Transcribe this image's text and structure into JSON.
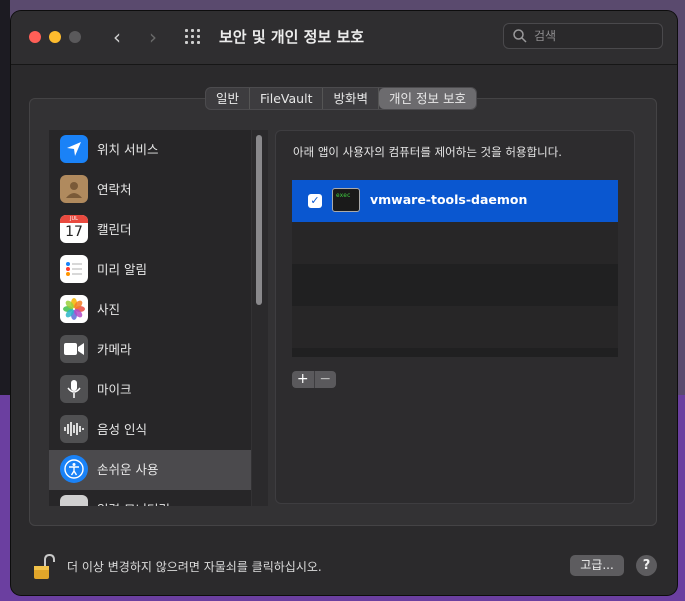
{
  "window": {
    "title": "보안 및 개인 정보 보호",
    "search_placeholder": "검색"
  },
  "tabs": [
    {
      "label": "일반",
      "active": false
    },
    {
      "label": "FileVault",
      "active": false
    },
    {
      "label": "방화벽",
      "active": false
    },
    {
      "label": "개인 정보 보호",
      "active": true
    }
  ],
  "sidebar": {
    "items": [
      {
        "label": "위치 서비스",
        "icon": "location-arrow-icon"
      },
      {
        "label": "연락처",
        "icon": "contacts-icon"
      },
      {
        "label": "캘린더",
        "icon": "calendar-icon",
        "calendar_month": "JUL",
        "calendar_day": "17"
      },
      {
        "label": "미리 알림",
        "icon": "reminders-icon"
      },
      {
        "label": "사진",
        "icon": "photos-icon"
      },
      {
        "label": "카메라",
        "icon": "camera-icon"
      },
      {
        "label": "마이크",
        "icon": "microphone-icon"
      },
      {
        "label": "음성 인식",
        "icon": "speech-recognition-icon"
      },
      {
        "label": "손쉬운 사용",
        "icon": "accessibility-icon",
        "selected": true
      },
      {
        "label": "입력 모니터링",
        "icon": "keyboard-icon"
      }
    ]
  },
  "panel": {
    "description": "아래 앱이 사용자의 컴퓨터를 제어하는 것을 허용합니다.",
    "apps": [
      {
        "name": "vmware-tools-daemon",
        "checked": true,
        "icon": "terminal-icon"
      }
    ],
    "add_label": "+",
    "remove_label": "−"
  },
  "footer": {
    "lock_text": "더 이상 변경하지 않으려면 자물쇠를 클릭하십시오.",
    "advanced_label": "고급...",
    "help_label": "?"
  },
  "colors": {
    "selection_blue": "#0a57d0",
    "accessibility_blue": "#1a82f7"
  }
}
